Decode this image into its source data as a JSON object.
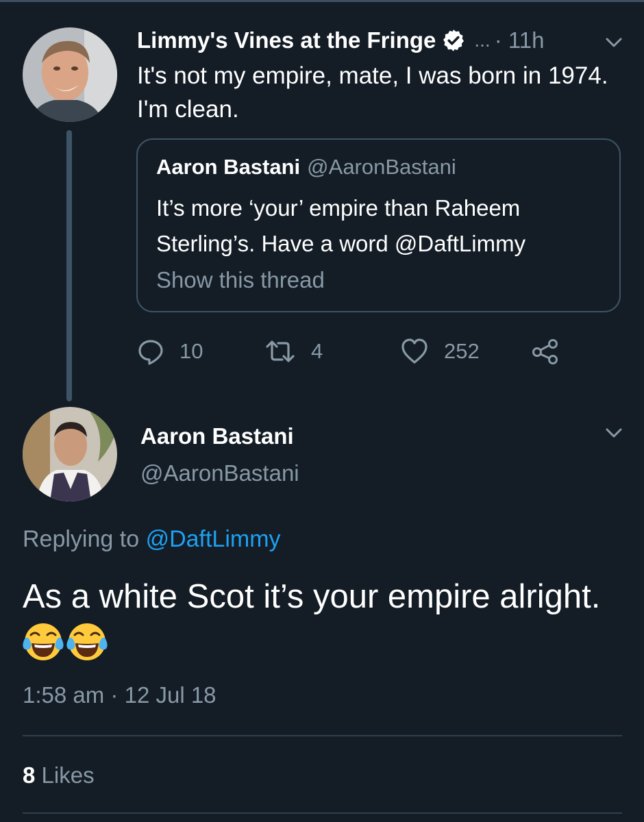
{
  "colors": {
    "background": "#141d26",
    "secondary_text": "#8899a6",
    "link": "#1da1f2",
    "border": "#3d5466"
  },
  "tweet1": {
    "display_name": "Limmy's Vines at the Fringe",
    "verified_icon": "verified-badge-icon",
    "dots": "...",
    "separator": "·",
    "time": "11h",
    "text": "It's not my empire, mate, I was born in 1974. I'm clean.",
    "quoted": {
      "display_name": "Aaron Bastani",
      "handle": "@AaronBastani",
      "text": "It’s more ‘your’ empire than Raheem Sterling’s. Have a word @DaftLimmy",
      "link": "Show this thread"
    },
    "actions": {
      "reply_icon": "reply-icon",
      "reply_count": "10",
      "retweet_icon": "retweet-icon",
      "retweet_count": "4",
      "like_icon": "heart-icon",
      "like_count": "252",
      "share_icon": "share-icon"
    }
  },
  "tweet2": {
    "display_name": "Aaron Bastani",
    "handle": "@AaronBastani",
    "replying_prefix": "Replying to",
    "replying_to": "@DaftLimmy",
    "text": "As a white Scot it’s your empire alright.",
    "emoji": [
      "face-with-tears-of-joy-emoji",
      "face-with-tears-of-joy-emoji"
    ],
    "time": "1:58 am",
    "separator": "·",
    "date": "12 Jul 18",
    "likes_count": "8",
    "likes_label": "Likes"
  }
}
